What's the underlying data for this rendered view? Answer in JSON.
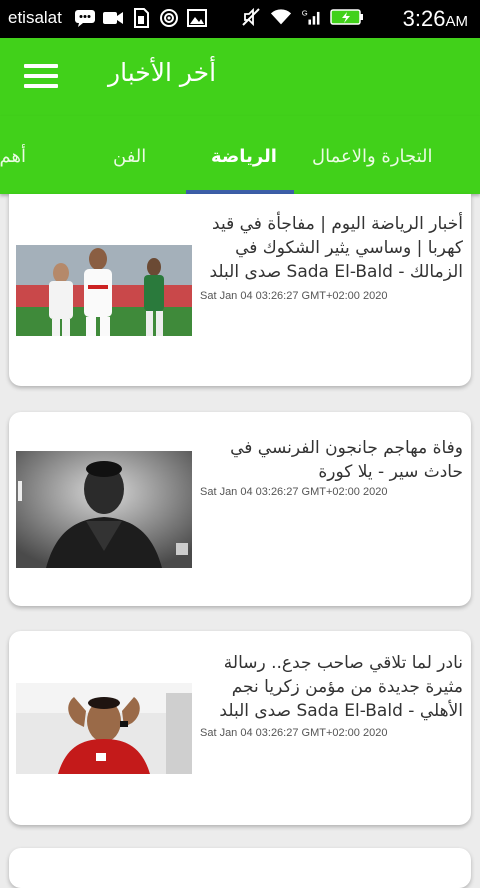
{
  "status_bar": {
    "carrier": "etisalat",
    "time": "3:26",
    "ampm": "AM",
    "icons": [
      "chat-icon",
      "video-icon",
      "sim-icon",
      "hotspot-icon",
      "image-icon",
      "mute-icon",
      "wifi-icon",
      "signal-icon",
      "battery-icon"
    ]
  },
  "app_bar": {
    "title": "أخر الأخبار",
    "menu_icon": "hamburger-menu-icon"
  },
  "tabs": {
    "items": [
      {
        "label": "التجارة والاعمال"
      },
      {
        "label": "الرياضة",
        "active": true
      },
      {
        "label": "الفن"
      },
      {
        "label": "أهم الأخبار"
      }
    ]
  },
  "colors": {
    "primary": "#41d11a",
    "indicator": "#3c5fa8",
    "background": "#ececec"
  },
  "articles": [
    {
      "title": "أخبار الرياضة اليوم | مفاجأة في قيد كهربا | وساسي يثير الشكوك في الزمالك - Sada El-Bald صدى البلد",
      "date": "Sat Jan 04 03:26:27 GMT+02:00 2020"
    },
    {
      "title": "وفاة مهاجم جانجون الفرنسي في حادث سير - يلا كورة",
      "date": "Sat Jan 04 03:26:27 GMT+02:00 2020"
    },
    {
      "title": "نادر لما تلاقي صاحب جدع.. رسالة مثيرة جديدة من مؤمن زكريا نجم الأهلي - Sada El-Bald صدى البلد",
      "date": "Sat Jan 04 03:26:27 GMT+02:00 2020"
    }
  ]
}
